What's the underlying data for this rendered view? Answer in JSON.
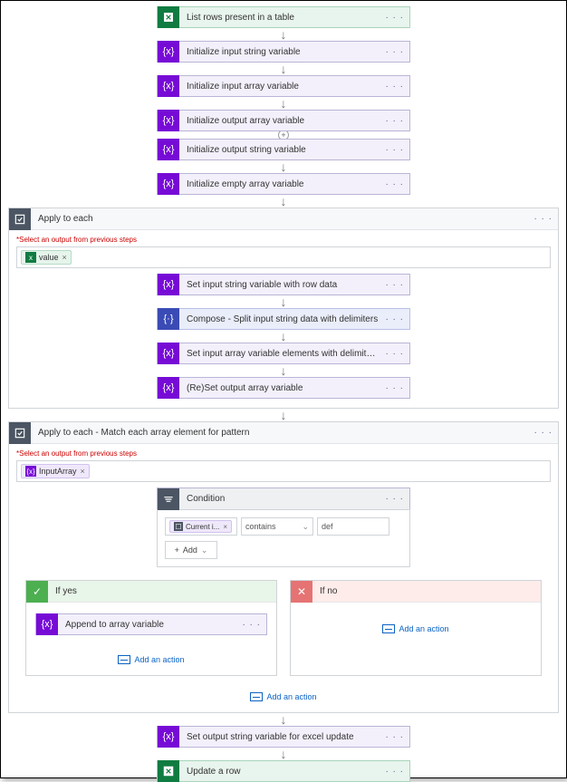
{
  "steps": {
    "excelList": "List rows present in a table",
    "initInputStr": "Initialize input string variable",
    "initInputArr": "Initialize input array variable",
    "initOutputArr": "Initialize output array variable",
    "initOutputStr": "Initialize output string variable",
    "initEmptyArr": "Initialize empty array variable"
  },
  "outerLoop": {
    "title": "Apply to each",
    "hint": "*Select an output from previous steps",
    "tokenValue": "value",
    "step1": "Set input string variable with row data",
    "step2": "Compose - Split input string data with delimiters",
    "step3": "Set input array variable elements with delimited data",
    "step4": "(Re)Set output array variable"
  },
  "innerLoop": {
    "title": "Apply to each - Match each array element for pattern",
    "hint": "*Select an output from previous steps",
    "tokenValue": "InputArray"
  },
  "condition": {
    "title": "Condition",
    "leftToken": "Current i...",
    "operator": "contains",
    "rightValue": "def",
    "addLabel": "Add"
  },
  "branchYes": {
    "title": "If yes",
    "step": "Append to array variable",
    "addAction": "Add an action"
  },
  "branchNo": {
    "title": "If no",
    "addAction": "Add an action"
  },
  "centerAddAction": "Add an action",
  "finalSteps": {
    "setOutput": "Set output string variable for excel update",
    "updateRow": "Update a row"
  },
  "menuDots": "· · ·"
}
